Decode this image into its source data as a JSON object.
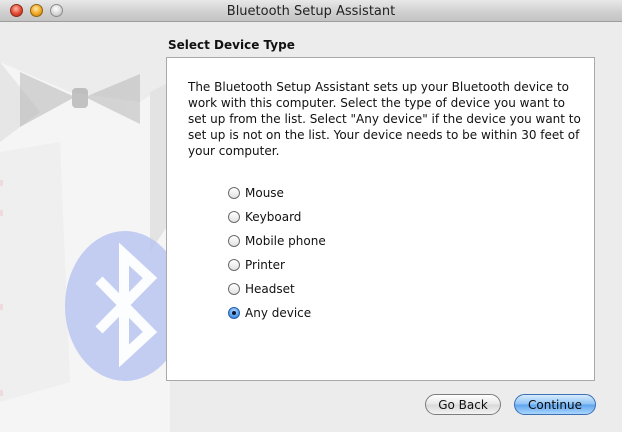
{
  "window": {
    "title": "Bluetooth Setup Assistant"
  },
  "header": {
    "section_title": "Select Device Type"
  },
  "main": {
    "description": "The Bluetooth Setup Assistant sets up your Bluetooth device to work with this computer. Select the type of device you want to set up from the list. Select \"Any device\" if the device you want to set up is not on the list. Your device needs to be within 30 feet of your computer.",
    "device_types": [
      {
        "label": "Mouse",
        "selected": false
      },
      {
        "label": "Keyboard",
        "selected": false
      },
      {
        "label": "Mobile phone",
        "selected": false
      },
      {
        "label": "Printer",
        "selected": false
      },
      {
        "label": "Headset",
        "selected": false
      },
      {
        "label": "Any device",
        "selected": true
      }
    ]
  },
  "footer": {
    "back_label": "Go Back",
    "continue_label": "Continue"
  },
  "colors": {
    "accent": "#5ea4ee",
    "bluetooth_logo": "#b9c6f0"
  },
  "icons": {
    "side_art": "tuxedo-bowtie-bluetooth-logo"
  }
}
